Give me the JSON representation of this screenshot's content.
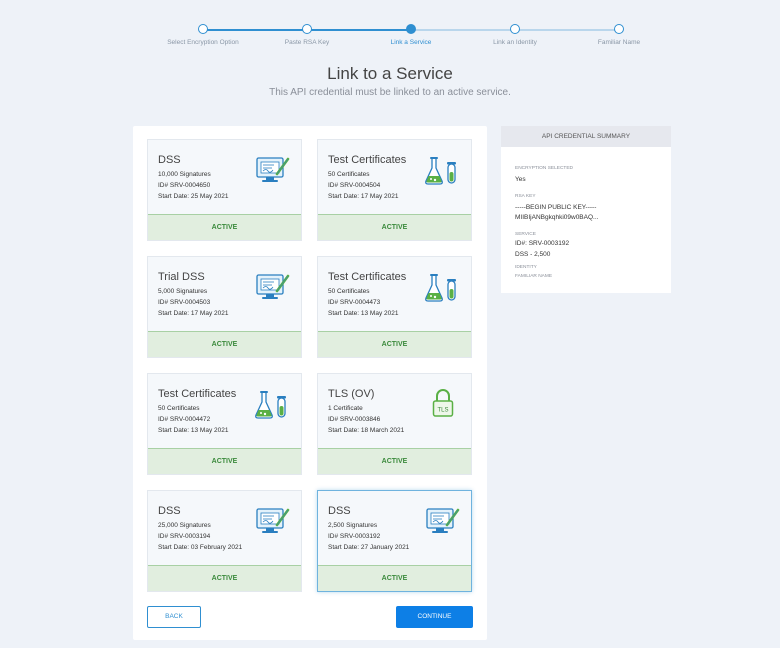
{
  "stepper": {
    "steps": [
      {
        "label": "Select Encryption Option"
      },
      {
        "label": "Paste RSA Key"
      },
      {
        "label": "Link a Service"
      },
      {
        "label": "Link an Identity"
      },
      {
        "label": "Familiar Name"
      }
    ],
    "current_index": 2
  },
  "header": {
    "title": "Link to a Service",
    "subtitle": "This API credential must be linked to an active service."
  },
  "services": [
    {
      "name": "DSS",
      "quantity": "10,000 Signatures",
      "id": "ID# SRV-0004650",
      "start": "Start Date: 25 May 2021",
      "status": "ACTIVE",
      "icon": "signature-document-icon"
    },
    {
      "name": "Test Certificates",
      "quantity": "50 Certificates",
      "id": "ID# SRV-0004504",
      "start": "Start Date: 17 May 2021",
      "status": "ACTIVE",
      "icon": "lab-flask-icon"
    },
    {
      "name": "Trial DSS",
      "quantity": "5,000 Signatures",
      "id": "ID# SRV-0004503",
      "start": "Start Date: 17 May 2021",
      "status": "ACTIVE",
      "icon": "signature-document-icon"
    },
    {
      "name": "Test Certificates",
      "quantity": "50 Certificates",
      "id": "ID# SRV-0004473",
      "start": "Start Date: 13 May 2021",
      "status": "ACTIVE",
      "icon": "lab-flask-icon"
    },
    {
      "name": "Test Certificates",
      "quantity": "50 Certificates",
      "id": "ID# SRV-0004472",
      "start": "Start Date: 13 May 2021",
      "status": "ACTIVE",
      "icon": "lab-flask-icon"
    },
    {
      "name": "TLS (OV)",
      "quantity": "1 Certificate",
      "id": "ID# SRV-0003846",
      "start": "Start Date: 18 March 2021",
      "status": "ACTIVE",
      "icon": "tls-lock-icon"
    },
    {
      "name": "DSS",
      "quantity": "25,000 Signatures",
      "id": "ID# SRV-0003194",
      "start": "Start Date: 03 February 2021",
      "status": "ACTIVE",
      "icon": "signature-document-icon"
    },
    {
      "name": "DSS",
      "quantity": "2,500 Signatures",
      "id": "ID# SRV-0003192",
      "start": "Start Date: 27 January 2021",
      "status": "ACTIVE",
      "icon": "signature-document-icon"
    }
  ],
  "selected_index": 7,
  "actions": {
    "back_label": "BACK",
    "continue_label": "CONTINUE"
  },
  "summary": {
    "title": "API CREDENTIAL SUMMARY",
    "encryption_label": "ENCRYPTION SELECTED",
    "encryption_value": "Yes",
    "rsa_label": "RSA KEY",
    "rsa_line1": "-----BEGIN PUBLIC KEY-----",
    "rsa_line2": "MIIBIjANBgkqhki09w0BAQ...",
    "service_label": "SERVICE",
    "service_id": "ID#: SRV-0003192",
    "service_detail": "DSS - 2,500",
    "identity_label": "IDENTITY",
    "familiar_label": "FAMILIAR NAME"
  },
  "colors": {
    "accent": "#2f8fd1",
    "active_green": "#3b8a3c",
    "active_bg": "#e1eedf",
    "continue_bg": "#0d7fe6"
  },
  "tls_icon_text": "TLS"
}
